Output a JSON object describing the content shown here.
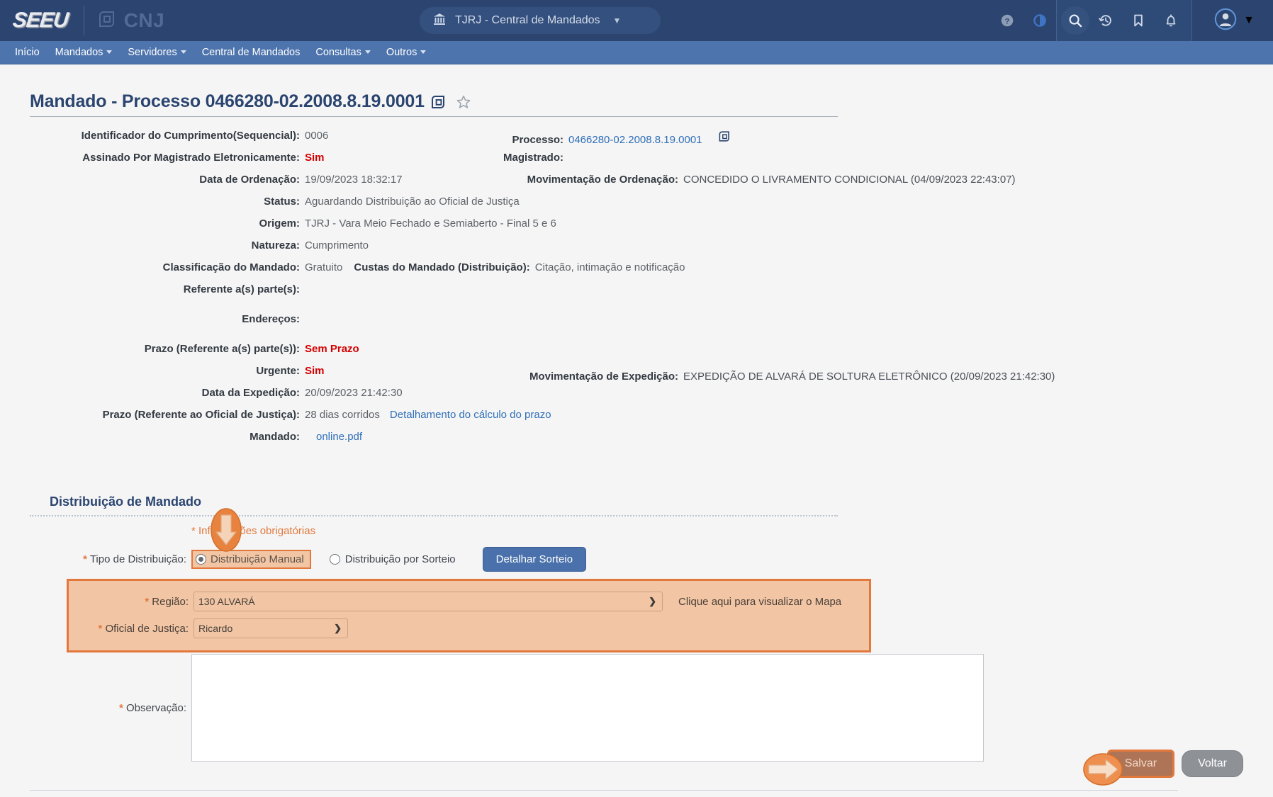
{
  "header": {
    "brand": "SEEU",
    "partner": "CNJ",
    "org_selector": "TJRJ - Central de Mandados",
    "icons": [
      {
        "name": "help-icon",
        "glyph": "?"
      },
      {
        "name": "contrast-icon",
        "glyph": "◐"
      },
      {
        "name": "search-icon",
        "glyph": "⌕"
      },
      {
        "name": "history-icon",
        "glyph": "↺"
      },
      {
        "name": "bookmark-icon",
        "glyph": "⚑"
      },
      {
        "name": "bell-icon",
        "glyph": "␇"
      }
    ],
    "accent_dark": "#2b4570",
    "accent_menu": "#4e74ad"
  },
  "menu": {
    "items": [
      {
        "label": "Início",
        "has_caret": false
      },
      {
        "label": "Mandados",
        "has_caret": true
      },
      {
        "label": "Servidores",
        "has_caret": true
      },
      {
        "label": "Central de Mandados",
        "has_caret": false
      },
      {
        "label": "Consultas",
        "has_caret": true
      },
      {
        "label": "Outros",
        "has_caret": true
      }
    ]
  },
  "page": {
    "title": "Mandado - Processo 0466280-02.2008.8.19.0001"
  },
  "details": {
    "left": [
      {
        "label": "Identificador do Cumprimento(Sequencial):",
        "value": "0006",
        "style": "light"
      },
      {
        "label": "Assinado Por Magistrado Eletronicamente:",
        "value": "Sim",
        "style": "red"
      },
      {
        "label": "Data de Ordenação:",
        "value": "19/09/2023 18:32:17",
        "style": "light"
      },
      {
        "label": "Status:",
        "value": "Aguardando Distribuição ao Oficial de Justiça",
        "style": "light"
      },
      {
        "label": "Origem:",
        "value": "TJRJ - Vara Meio Fechado e Semiaberto - Final 5 e 6",
        "style": "light"
      },
      {
        "label": "Natureza:",
        "value": "Cumprimento",
        "style": "light"
      }
    ],
    "classificacao": {
      "label": "Classificação do Mandado:",
      "value": "Gratuito",
      "label2": "Custas do Mandado (Distribuição):",
      "value2": "Citação, intimação e notificação"
    },
    "referente_partes": {
      "label": "Referente a(s) parte(s):",
      "value": ""
    },
    "enderecos": {
      "label": "Endereços:",
      "value": ""
    },
    "prazo_partes": {
      "label": "Prazo (Referente a(s) parte(s)):",
      "value": "Sem Prazo"
    },
    "urgente": {
      "label": "Urgente:",
      "value": "Sim"
    },
    "data_expedicao": {
      "label": "Data da Expedição:",
      "value": "20/09/2023 21:42:30"
    },
    "prazo_oficial": {
      "label": "Prazo (Referente ao Oficial de Justiça):",
      "value": "28 dias corridos",
      "link": "Detalhamento do cálculo do prazo"
    },
    "mandado_file": {
      "label": "Mandado:",
      "value": "online.pdf"
    },
    "right": {
      "processo_label": "Processo:",
      "processo_value": "0466280-02.2008.8.19.0001",
      "magistrado_label": "Magistrado:",
      "magistrado_value": "",
      "mov_ordenacao_label": "Movimentação de Ordenação:",
      "mov_ordenacao_value": "CONCEDIDO O LIVRAMENTO CONDICIONAL (04/09/2023 22:43:07)",
      "mov_expedicao_label": "Movimentação de Expedição:",
      "mov_expedicao_value": "EXPEDIÇÃO DE ALVARÁ DE SOLTURA ELETRÔNICO (20/09/2023 21:42:30)"
    }
  },
  "distribuicao": {
    "section_title": "Distribuição de Mandado",
    "obrigatorias": "* Informações obrigatórias",
    "tipo_label": "Tipo de Distribuição:",
    "radio_manual": "Distribuição Manual",
    "radio_sorteio": "Distribuição por Sorteio",
    "selected_tipo": "Distribuição Manual",
    "btn_detalhar": "Detalhar Sorteio",
    "regiao_label": "Região:",
    "regiao_value": "130 ALVARÁ",
    "regiao_options": [
      "130 ALVARÁ"
    ],
    "oficial_label": "Oficial de Justiça:",
    "oficial_value": "Ricardo",
    "oficial_options": [
      "Ricardo"
    ],
    "map_link": "Clique aqui para visualizar o Mapa",
    "observacao_label": "Observação:",
    "observacao_value": "",
    "highlight_color": "#e2783c",
    "panel_fill": "#f2c5a4"
  },
  "footer": {
    "salvar": "Salvar",
    "voltar": "Voltar"
  },
  "annotations": {
    "down_arrow": "down-arrow-annotation",
    "right_arrow": "right-arrow-annotation"
  }
}
